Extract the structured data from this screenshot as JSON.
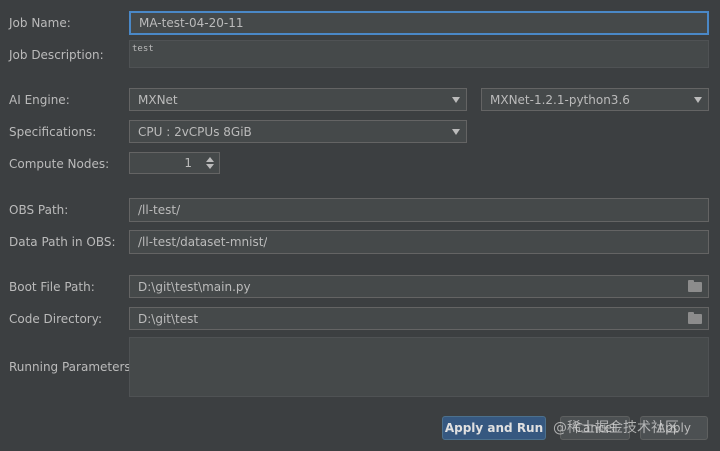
{
  "labels": {
    "job_name": "Job Name:",
    "job_description": "Job Description:",
    "ai_engine": "AI Engine:",
    "specifications": "Specifications:",
    "compute_nodes": "Compute Nodes:",
    "obs_path": "OBS Path:",
    "data_path": "Data Path in OBS:",
    "boot_file": "Boot File Path:",
    "code_directory": "Code Directory:",
    "running_parameters": "Running Parameters:"
  },
  "values": {
    "job_name": "MA-test-04-20-11",
    "job_description": "test",
    "ai_engine": "MXNet",
    "engine_version": "MXNet-1.2.1-python3.6",
    "specifications": "CPU : 2vCPUs 8GiB",
    "compute_nodes": "1",
    "obs_path": "/ll-test/",
    "data_path": "/ll-test/dataset-mnist/",
    "boot_file": "D:\\git\\test\\main.py",
    "code_directory": "D:\\git\\test",
    "running_parameters": ""
  },
  "buttons": {
    "apply_and_run": "Apply and Run",
    "cancel": "Cancel",
    "apply": "Apply"
  },
  "watermark": "@稀土掘金技术社区",
  "icons": {
    "dropdown": "chevron-down-icon",
    "folder": "folder-icon",
    "spinner": "spinner-arrows-icon"
  },
  "colors": {
    "background": "#3c3f41",
    "field": "#45494a",
    "focus_border": "#4a88c7",
    "primary_button": "#365880"
  }
}
